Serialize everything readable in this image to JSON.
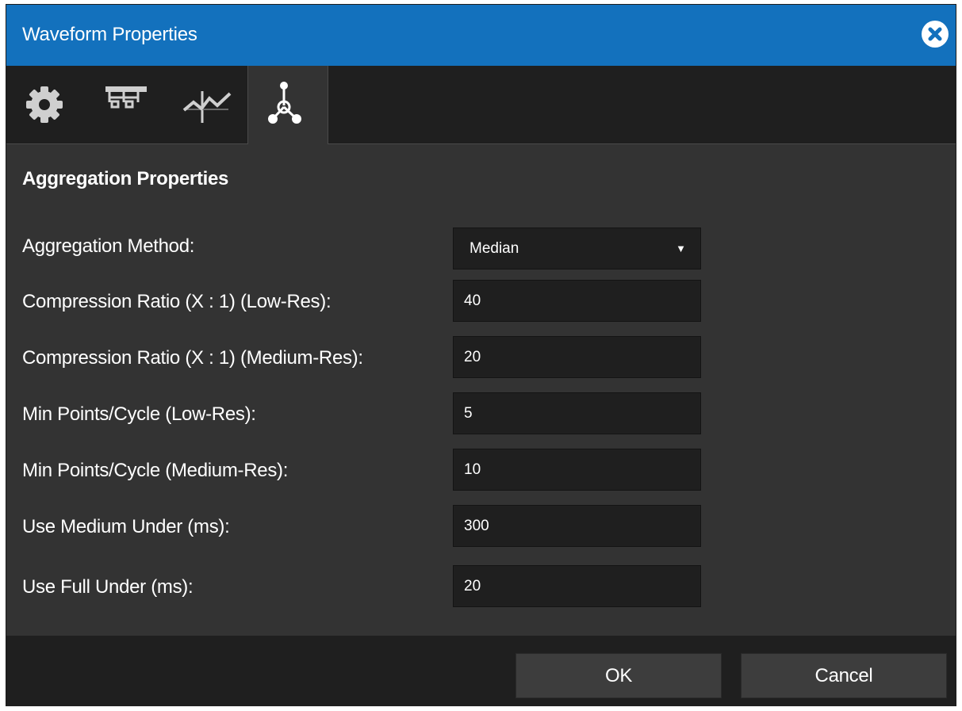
{
  "dialog": {
    "title": "Waveform Properties",
    "close_icon": "close-circle-icon"
  },
  "tabs": [
    {
      "name": "general",
      "icon": "gear-icon",
      "active": false
    },
    {
      "name": "hierarchy",
      "icon": "hierarchy-icon",
      "active": false
    },
    {
      "name": "waveform",
      "icon": "waveform-icon",
      "active": false
    },
    {
      "name": "aggregation",
      "icon": "aggregation-icon",
      "active": true
    }
  ],
  "section": {
    "title": "Aggregation Properties"
  },
  "fields": {
    "aggregation_method": {
      "label": "Aggregation Method:",
      "value": "Median",
      "options_indicator": "▼"
    },
    "compression_low": {
      "label": "Compression Ratio (X : 1) (Low-Res):",
      "value": "40"
    },
    "compression_medium": {
      "label": "Compression Ratio (X : 1) (Medium-Res):",
      "value": "20"
    },
    "min_points_low": {
      "label": "Min Points/Cycle (Low-Res):",
      "value": "5"
    },
    "min_points_medium": {
      "label": "Min Points/Cycle (Medium-Res):",
      "value": "10"
    },
    "use_medium_under": {
      "label": "Use Medium Under (ms):",
      "value": "300"
    },
    "use_full_under": {
      "label": "Use Full Under (ms):",
      "value": "20"
    }
  },
  "footer": {
    "ok_label": "OK",
    "cancel_label": "Cancel"
  },
  "colors": {
    "titlebar": "#1371bd",
    "background": "#333333",
    "field_background": "#1f1f1f",
    "text": "#ffffff"
  }
}
